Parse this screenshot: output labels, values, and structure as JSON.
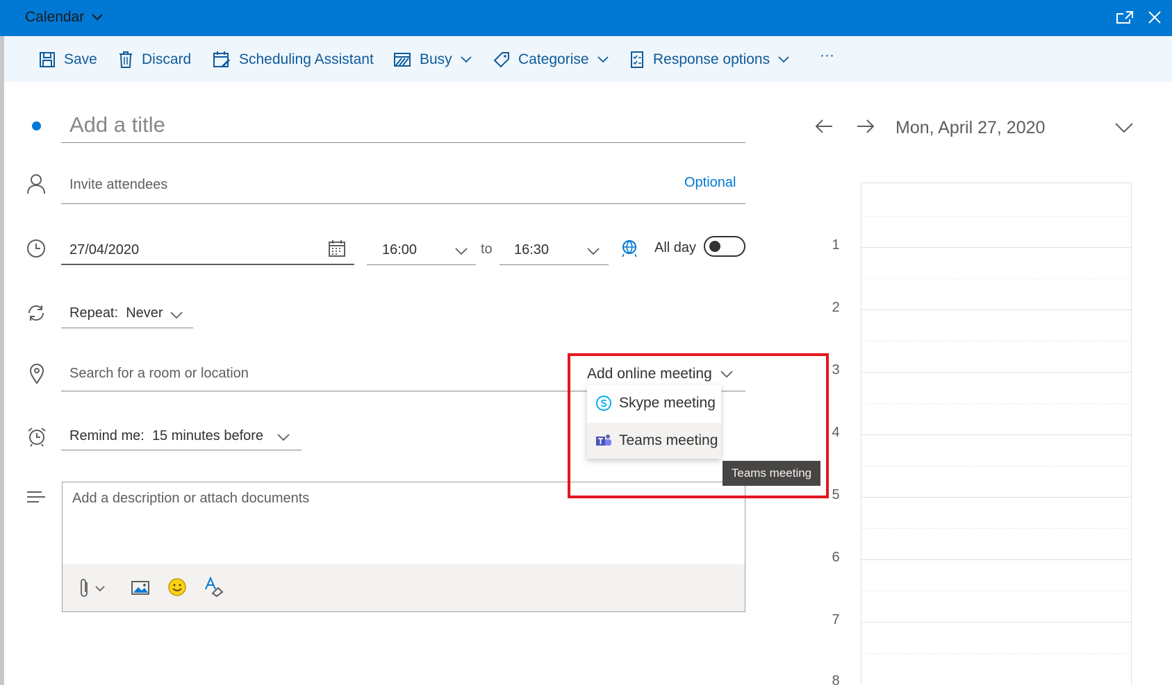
{
  "titlebar": {
    "title": "Calendar"
  },
  "toolbar": {
    "save": "Save",
    "discard": "Discard",
    "scheduling": "Scheduling Assistant",
    "busy": "Busy",
    "categorise": "Categorise",
    "response": "Response options",
    "more": "···"
  },
  "form": {
    "title_placeholder": "Add a title",
    "attendees_placeholder": "Invite attendees",
    "optional": "Optional",
    "date": "27/04/2020",
    "start_time": "16:00",
    "to": "to",
    "end_time": "16:30",
    "all_day": "All day",
    "all_day_on": false,
    "repeat_label": "Repeat:",
    "repeat_value": "Never",
    "location_placeholder": "Search for a room or location",
    "online_meeting": "Add online meeting",
    "remind_label": "Remind me:",
    "remind_value": "15 minutes before",
    "description_placeholder": "Add a description or attach documents"
  },
  "menu": {
    "items": [
      "Skype meeting",
      "Teams meeting"
    ],
    "tooltip": "Teams meeting"
  },
  "dayview": {
    "date": "Mon, April 27, 2020",
    "hours": [
      "1",
      "2",
      "3",
      "4",
      "5",
      "6",
      "7",
      "8"
    ]
  },
  "colors": {
    "accent": "#0078d4",
    "highlight": "#e3161f"
  }
}
